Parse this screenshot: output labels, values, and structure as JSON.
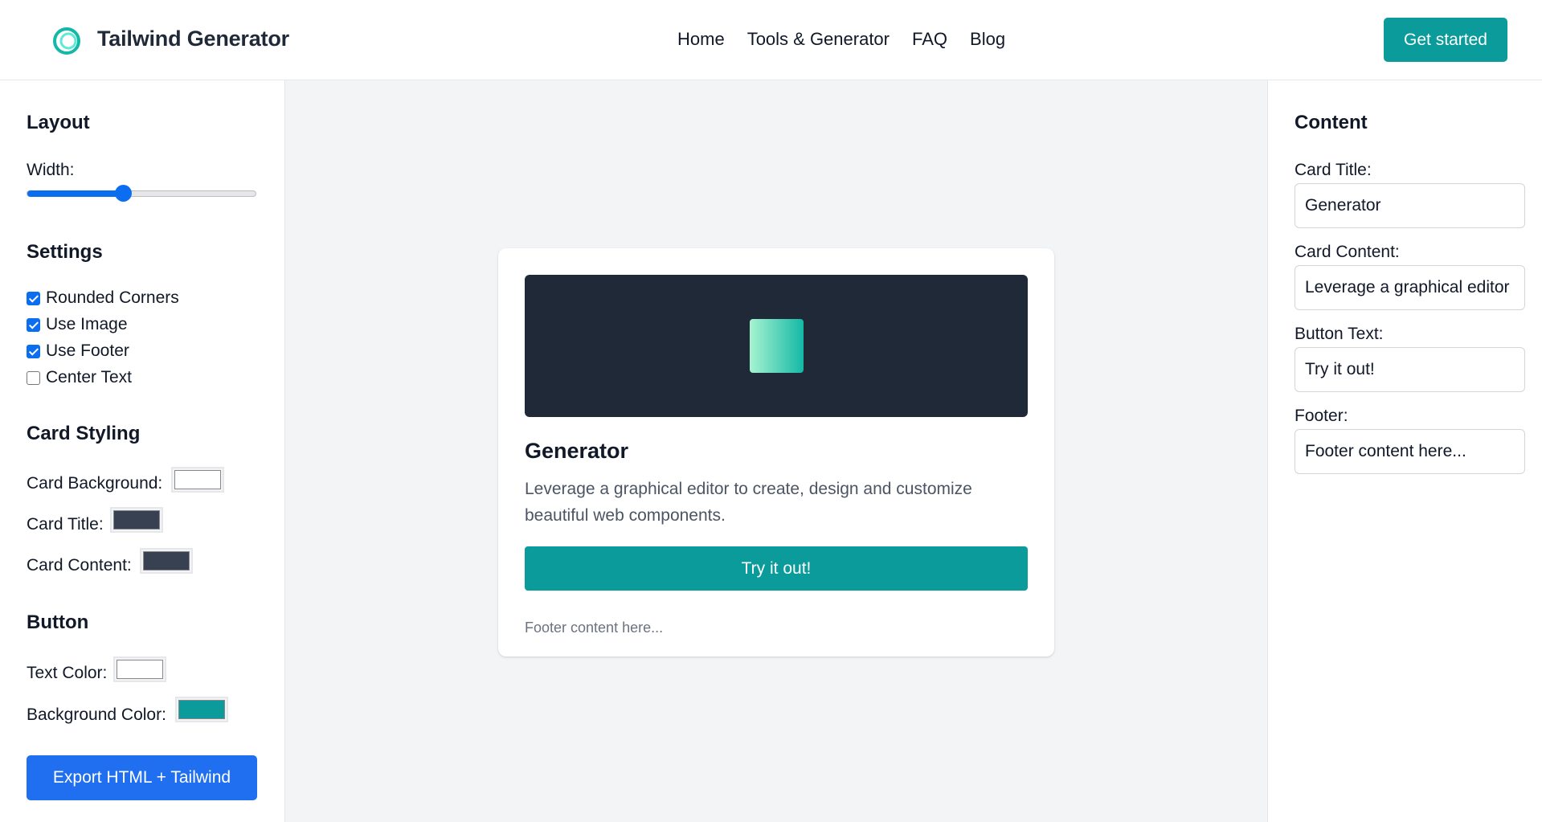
{
  "header": {
    "brand": "Tailwind Generator",
    "nav": [
      "Home",
      "Tools & Generator",
      "FAQ",
      "Blog"
    ],
    "cta": "Get started"
  },
  "left_panel": {
    "layout_title": "Layout",
    "width_label": "Width:",
    "width_value": 0.42,
    "settings_title": "Settings",
    "settings": [
      {
        "label": "Rounded Corners",
        "checked": true
      },
      {
        "label": "Use Image",
        "checked": true
      },
      {
        "label": "Use Footer",
        "checked": true
      },
      {
        "label": "Center Text",
        "checked": false
      }
    ],
    "card_styling_title": "Card Styling",
    "card_background_label": "Card Background:",
    "card_background_color": "#ffffff",
    "card_title_label": "Card Title:",
    "card_title_color": "#374151",
    "card_content_label": "Card Content:",
    "card_content_color": "#374151",
    "button_title": "Button",
    "text_color_label": "Text Color:",
    "text_color": "#ffffff",
    "bg_color_label": "Background Color:",
    "bg_color": "#0b9b9b",
    "export_label": "Export HTML + Tailwind"
  },
  "preview": {
    "title": "Generator",
    "content": "Leverage a graphical editor to create, design and customize beautiful web components.",
    "button": "Try it out!",
    "footer": "Footer content here..."
  },
  "right_panel": {
    "title": "Content",
    "card_title_label": "Card Title:",
    "card_title_value": "Generator",
    "card_content_label": "Card Content:",
    "card_content_value": "Leverage a graphical editor",
    "button_text_label": "Button Text:",
    "button_text_value": "Try it out!",
    "footer_label": "Footer:",
    "footer_value": "Footer content here..."
  },
  "colors": {
    "accent_teal": "#0b9b9b",
    "primary_blue": "#1f6ff0",
    "image_bg": "#1f2937"
  }
}
